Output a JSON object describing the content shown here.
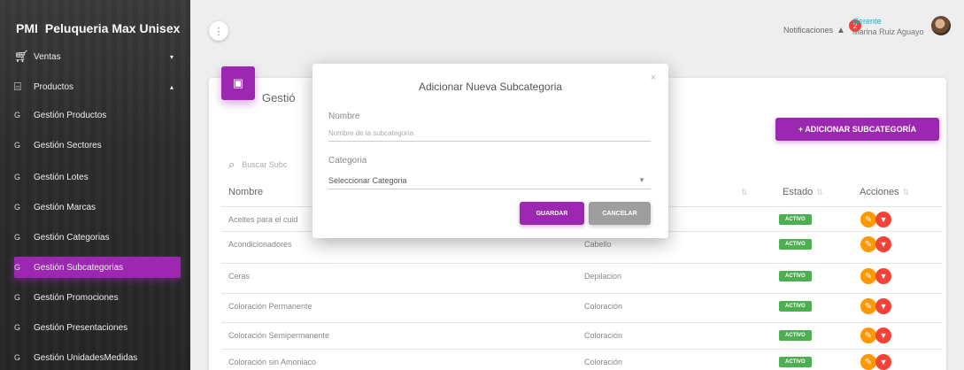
{
  "brand": {
    "abbr": "PMI",
    "name": "Peluqueria Max Unisex"
  },
  "sidebar": {
    "items": [
      {
        "icon": "cart-icon",
        "glyph": "🛒",
        "label": "Ventas",
        "caret": "▾"
      },
      {
        "icon": "basket-icon",
        "glyph": "🧺",
        "label": "Productos",
        "caret": "▴"
      },
      {
        "bullet": "G",
        "label": "Gestión Productos"
      },
      {
        "bullet": "G",
        "label": "Gestión Sectores"
      },
      {
        "bullet": "G",
        "label": "Gestión Lotes"
      },
      {
        "bullet": "G",
        "label": "Gestión Marcas"
      },
      {
        "bullet": "G",
        "label": "Gestión Categorias"
      },
      {
        "bullet": "G",
        "label": "Gestión Subcategorias",
        "active": true
      },
      {
        "bullet": "G",
        "label": "Gestión Promociones"
      },
      {
        "bullet": "G",
        "label": "Gestión Presentaciones"
      },
      {
        "bullet": "G",
        "label": "Gestión UnidadesMedidas"
      }
    ]
  },
  "topbar": {
    "menu_glyph": "⋮",
    "notifications_label": "Notificaciones",
    "notifications_count": "2",
    "user_role": "Gerente",
    "user_name": "Marina Ruiz Aguayo"
  },
  "card": {
    "icon": "clipboard-icon",
    "title": "Gestió",
    "add_button": "+ ADICIONAR SUBCATEGORÍA",
    "search_placeholder": "Buscar Subc",
    "headers": {
      "name": "Nombre",
      "status": "Estado",
      "actions": "Acciones",
      "sort": "⇅"
    },
    "rows": [
      {
        "name": "Aceites para el cuid",
        "category": "",
        "status": "ACTIVO"
      },
      {
        "name": "Acondicionadores",
        "category": "Cabello",
        "status": "ACTIVO"
      },
      {
        "name": "Ceras",
        "category": "Depilacion",
        "status": "ACTIVO"
      },
      {
        "name": "Coloración Permanente",
        "category": "Coloración",
        "status": "ACTIVO"
      },
      {
        "name": "Coloración Semipermanente",
        "category": "Coloración",
        "status": "ACTIVO"
      },
      {
        "name": "Coloración sin Amoniaco",
        "category": "Coloración",
        "status": "ACTIVO"
      }
    ]
  },
  "modal": {
    "title": "Adicionar Nueva Subcategoria",
    "close": "×",
    "name_label": "Nombre",
    "name_placeholder": "Nombre de la subcategoria",
    "category_label": "Categoria",
    "category_value": "Seleccionar Categoria",
    "save": "GUARDAR",
    "cancel": "CANCELAR"
  },
  "colors": {
    "accent": "#9c27b0",
    "success": "#4caf50",
    "edit": "#ff9800",
    "delete": "#f44336"
  }
}
